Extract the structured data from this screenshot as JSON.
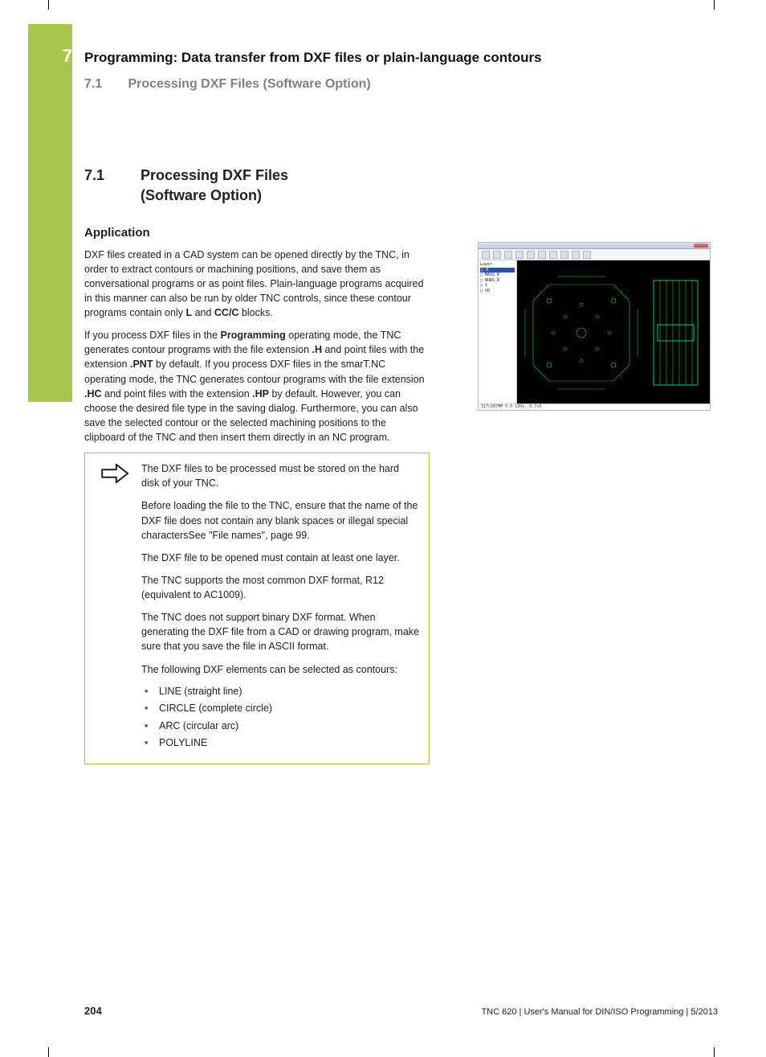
{
  "chapter": {
    "number": "7",
    "title": "Programming: Data transfer from DXF files or plain-language contours",
    "running_section_num": "7.1",
    "running_section_title": "Processing DXF Files (Software Option)"
  },
  "section": {
    "num": "7.1",
    "title": "Processing DXF Files (Software Option)"
  },
  "subheading": "Application",
  "para1_plain_a": "DXF files created in a CAD system can be opened directly by the TNC, in order to extract contours or machining positions, and save them as conversational programs or as point files. Plain-language programs acquired in this manner can also be run by older TNC controls, since these contour programs contain only ",
  "para1_b1": "L",
  "para1_mid": " and ",
  "para1_b2": "CC/C",
  "para1_end": " blocks.",
  "para2_a": "If you process DXF files in the ",
  "para2_b1": "Programming",
  "para2_b": " operating mode, the TNC generates contour programs with the file extension ",
  "para2_bH": ".H",
  "para2_c": " and point files with the extension ",
  "para2_bPNT": ".PNT",
  "para2_d": " by default. If you process DXF files in the smarT.NC operating mode, the TNC generates contour programs with the file extension ",
  "para2_bHC": ".HC",
  "para2_e": " and point files with the extension ",
  "para2_bHP": ".HP",
  "para2_f": " by default. However, you can choose the desired file type in the saving dialog. Furthermore, you can also save the selected contour or the selected machining positions to the clipboard of the TNC and then insert them directly in an NC program.",
  "note": {
    "p1": "The DXF files to be processed must be stored on the hard disk of your TNC.",
    "p2": "Before loading the file to the TNC, ensure that the name of the DXF file does not contain any blank spaces or illegal special charactersSee \"File names\", page 99.",
    "p3": "The DXF file to be opened must contain at least one layer.",
    "p4": "The TNC supports the most common DXF format, R12 (equivalent to AC1009).",
    "p5": "The TNC does not support binary DXF format. When generating the DXF file from a CAD or drawing program, make sure that you save the file in ASCII format.",
    "p6": "The following DXF elements can be selected as contours:",
    "li1": "LINE (straight line)",
    "li2": "CIRCLE (complete circle)",
    "li3": "ARC (circular arc)",
    "li4": "POLYLINE"
  },
  "figure": {
    "side_header": "Layer",
    "side_sel": "□ 0",
    "side_l1": "□ MASS_K",
    "side_l2": "□ NURS_R",
    "side_l3": "□ 1",
    "side_l4": "□ U0",
    "status": "317×207MM   0.0   130z.   0.7x0"
  },
  "footer": {
    "page": "204",
    "doc": "TNC 620 | User's Manual for DIN/ISO Programming | 5/2013"
  }
}
